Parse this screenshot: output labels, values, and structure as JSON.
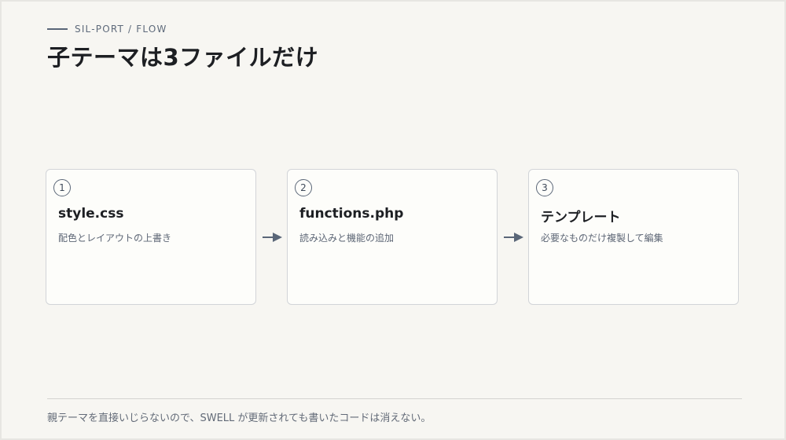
{
  "eyebrow": "SIL-PORT / FLOW",
  "title": "子テーマは3ファイルだけ",
  "steps": [
    {
      "number": "1",
      "title": "style.css",
      "description": "配色とレイアウトの上書き"
    },
    {
      "number": "2",
      "title": "functions.php",
      "description": "読み込みと機能の追加"
    },
    {
      "number": "3",
      "title": "テンプレート",
      "description": "必要なものだけ複製して編集"
    }
  ],
  "footer": "親テーマを直接いじらないので、SWELL が更新されても書いたコードは消えない。",
  "colors": {
    "background": "#f7f6f2",
    "card": "#fdfdfa",
    "accent": "#5a6678",
    "title_text": "#1d1f23"
  }
}
